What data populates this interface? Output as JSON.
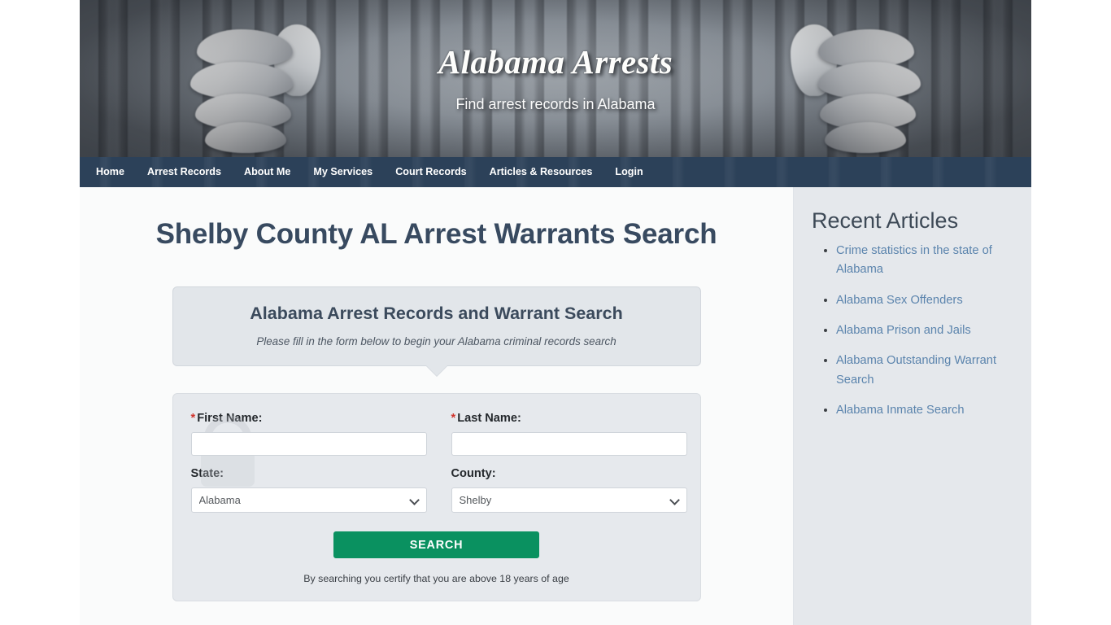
{
  "site": {
    "title": "Alabama Arrests",
    "tagline": "Find arrest records in Alabama"
  },
  "nav": {
    "items": [
      {
        "label": "Home",
        "name": "nav-item-home"
      },
      {
        "label": "Arrest Records",
        "name": "nav-item-arrest-records"
      },
      {
        "label": "About Me",
        "name": "nav-item-about-me"
      },
      {
        "label": "My Services",
        "name": "nav-item-my-services"
      },
      {
        "label": "Court Records",
        "name": "nav-item-court-records"
      },
      {
        "label": "Articles & Resources",
        "name": "nav-item-articles-resources"
      },
      {
        "label": "Login",
        "name": "nav-item-login"
      }
    ]
  },
  "main": {
    "page_title": "Shelby County AL Arrest Warrants Search",
    "callout": {
      "heading": "Alabama Arrest Records and Warrant Search",
      "subheading": "Please fill in the form below to begin your Alabama criminal records search"
    },
    "form": {
      "first_name": {
        "label": "First Name:",
        "required_mark": "*",
        "value": "",
        "placeholder": ""
      },
      "last_name": {
        "label": "Last Name:",
        "required_mark": "*",
        "value": "",
        "placeholder": ""
      },
      "state": {
        "label": "State:",
        "selected": "Alabama",
        "options": [
          "Alabama"
        ]
      },
      "county": {
        "label": "County:",
        "selected": "Shelby",
        "options": [
          "Shelby"
        ]
      },
      "submit_label": "SEARCH",
      "disclaimer": "By searching you certify that you are above 18 years of age"
    }
  },
  "sidebar": {
    "title": "Recent Articles",
    "articles": [
      {
        "label": "Crime statistics in the state of Alabama"
      },
      {
        "label": "Alabama Sex Offenders"
      },
      {
        "label": "Alabama Prison and Jails"
      },
      {
        "label": "Alabama Outstanding Warrant Search"
      },
      {
        "label": "Alabama Inmate Search"
      }
    ]
  },
  "colors": {
    "nav_bar": "#2c4159",
    "heading": "#384a60",
    "submit_button": "#0a9160",
    "link": "#5b84ad",
    "required_asterisk": "#d0342c",
    "sidebar_bg": "#e5e8ec",
    "panel_bg": "#e6e9ed"
  }
}
